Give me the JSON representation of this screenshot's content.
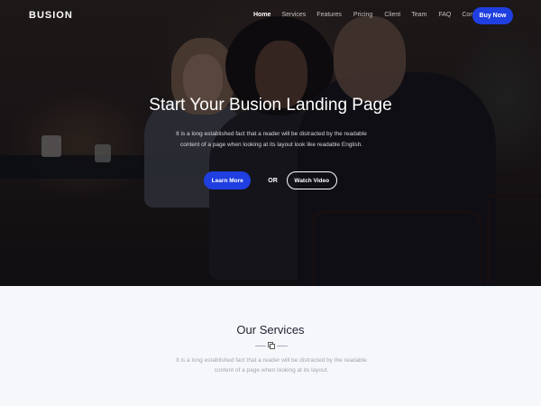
{
  "brand": {
    "logo": "BUSION",
    "accent": "#1f3fe0"
  },
  "nav": {
    "items": [
      {
        "label": "Home",
        "active": true
      },
      {
        "label": "Services",
        "active": false
      },
      {
        "label": "Features",
        "active": false
      },
      {
        "label": "Pricing",
        "active": false
      },
      {
        "label": "Client",
        "active": false
      },
      {
        "label": "Team",
        "active": false
      },
      {
        "label": "FAQ",
        "active": false
      },
      {
        "label": "Contact",
        "active": false
      }
    ],
    "cta_label": "Buy Now"
  },
  "hero": {
    "title": "Start Your Busion Landing Page",
    "description": "It is a long established fact that a reader will be distracted by the readable content of a page when looking at its layout look like readable English.",
    "primary_button": "Learn More",
    "separator": "OR",
    "secondary_button": "Watch Video"
  },
  "services": {
    "title": "Our Services",
    "divider_icon": "copy-icon",
    "description": "It is a long established fact that a reader will be distracted by the readable content of a page when looking at its layout."
  }
}
